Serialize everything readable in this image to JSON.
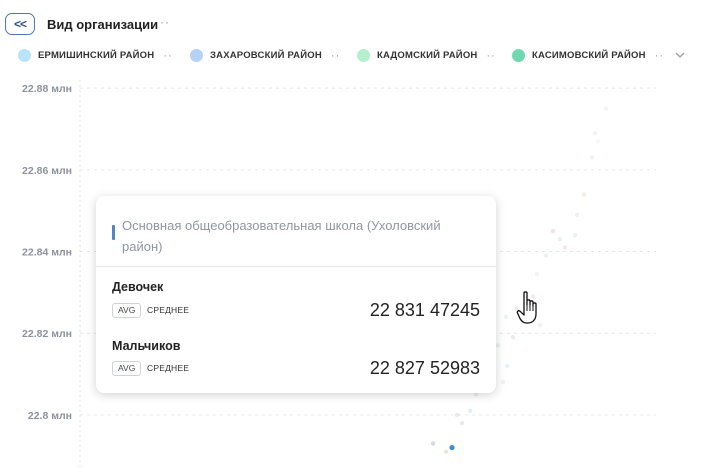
{
  "header": {
    "back_label": "<<",
    "title": "Вид организации",
    "more": "··"
  },
  "legend": {
    "items": [
      {
        "label": "ЕРМИШИНСКИЙ РАЙОН",
        "color": "#b9e3fb"
      },
      {
        "label": "ЗАХАРОВСКИЙ РАЙОН",
        "color": "#b6d2f6"
      },
      {
        "label": "КАДОМСКИЙ РАЙОН",
        "color": "#b4f0cc"
      },
      {
        "label": "КАСИМОВСКИЙ РАЙОН",
        "color": "#6fd8b0"
      }
    ],
    "more": "··"
  },
  "chart_data": {
    "type": "scatter",
    "y_ticks": [
      "22.88 млн",
      "22.86 млн",
      "22.84 млн",
      "22.82 млн",
      "22.8 млн"
    ],
    "y_tick_values": [
      22.88,
      22.86,
      22.84,
      22.82,
      22.8
    ],
    "ylim": [
      22.787,
      22.882
    ],
    "y_unit": "млн",
    "grid": true,
    "legend_position": "top",
    "highlight_color": "#3f8bd6",
    "points": [
      {
        "x": 452,
        "y": 22.792,
        "color": "#3f8bd6",
        "opacity": 1.0
      },
      {
        "x": 433,
        "y": 22.793,
        "color": "#c7d3e3",
        "opacity": 0.8
      },
      {
        "x": 446,
        "y": 22.791,
        "color": "#e3d9cf",
        "opacity": 0.7
      },
      {
        "x": 457,
        "y": 22.8,
        "color": "#d6e6dc",
        "opacity": 0.7
      },
      {
        "x": 462,
        "y": 22.798,
        "color": "#e8d7d1",
        "opacity": 0.6
      },
      {
        "x": 470,
        "y": 22.801,
        "color": "#cfe0ec",
        "opacity": 0.6
      },
      {
        "x": 476,
        "y": 22.805,
        "color": "#d8e8d8",
        "opacity": 0.6
      },
      {
        "x": 485,
        "y": 22.809,
        "color": "#f1d2cd",
        "opacity": 0.6
      },
      {
        "x": 494,
        "y": 22.813,
        "color": "#cfe3ee",
        "opacity": 0.6
      },
      {
        "x": 498,
        "y": 22.817,
        "color": "#d9e8d9",
        "opacity": 0.55
      },
      {
        "x": 507,
        "y": 22.812,
        "color": "#dbe7f1",
        "opacity": 0.55
      },
      {
        "x": 513,
        "y": 22.819,
        "color": "#ead9d2",
        "opacity": 0.55
      },
      {
        "x": 506,
        "y": 22.824,
        "color": "#d7e6da",
        "opacity": 0.5
      },
      {
        "x": 517,
        "y": 22.826,
        "color": "#cee0f0",
        "opacity": 0.55
      },
      {
        "x": 526,
        "y": 22.8268,
        "color": "#3f8bd6",
        "opacity": 1.0
      },
      {
        "x": 533,
        "y": 22.829,
        "color": "#f0d8d0",
        "opacity": 0.55
      },
      {
        "x": 540,
        "y": 22.822,
        "color": "#d8e8de",
        "opacity": 0.5
      },
      {
        "x": 546,
        "y": 22.839,
        "color": "#d5e6dc",
        "opacity": 0.5
      },
      {
        "x": 553,
        "y": 22.845,
        "color": "#e6d4cf",
        "opacity": 0.55
      },
      {
        "x": 560,
        "y": 22.843,
        "color": "#cfe1ec",
        "opacity": 0.5
      },
      {
        "x": 565,
        "y": 22.841,
        "color": "#f0d0cc",
        "opacity": 0.5
      },
      {
        "x": 575,
        "y": 22.844,
        "color": "#d3e5ef",
        "opacity": 0.55
      },
      {
        "x": 577,
        "y": 22.849,
        "color": "#d9e9dc",
        "opacity": 0.5
      },
      {
        "x": 584,
        "y": 22.854,
        "color": "#e7dcd2",
        "opacity": 0.45
      },
      {
        "x": 592,
        "y": 22.863,
        "color": "#dbe9f1",
        "opacity": 0.5
      },
      {
        "x": 595,
        "y": 22.869,
        "color": "#d4ecdf",
        "opacity": 0.5
      },
      {
        "x": 598,
        "y": 22.867,
        "color": "#e6ede4",
        "opacity": 0.45
      },
      {
        "x": 606,
        "y": 22.875,
        "color": "#dde8ee",
        "opacity": 0.4
      },
      {
        "x": 537,
        "y": 22.8345,
        "color": "#e2ebe2",
        "opacity": 0.45
      },
      {
        "x": 503,
        "y": 22.808,
        "color": "#f2dcd6",
        "opacity": 0.45
      }
    ]
  },
  "tooltip": {
    "title": "Основная общеобразовательная школа (Ухоловский район)",
    "rows": [
      {
        "name": "Девочек",
        "badge": "AVG",
        "agg": "СРЕДНЕЕ",
        "value": "22 831 47245"
      },
      {
        "name": "Мальчиков",
        "badge": "AVG",
        "agg": "СРЕДНЕЕ",
        "value": "22 827 52983"
      }
    ]
  }
}
